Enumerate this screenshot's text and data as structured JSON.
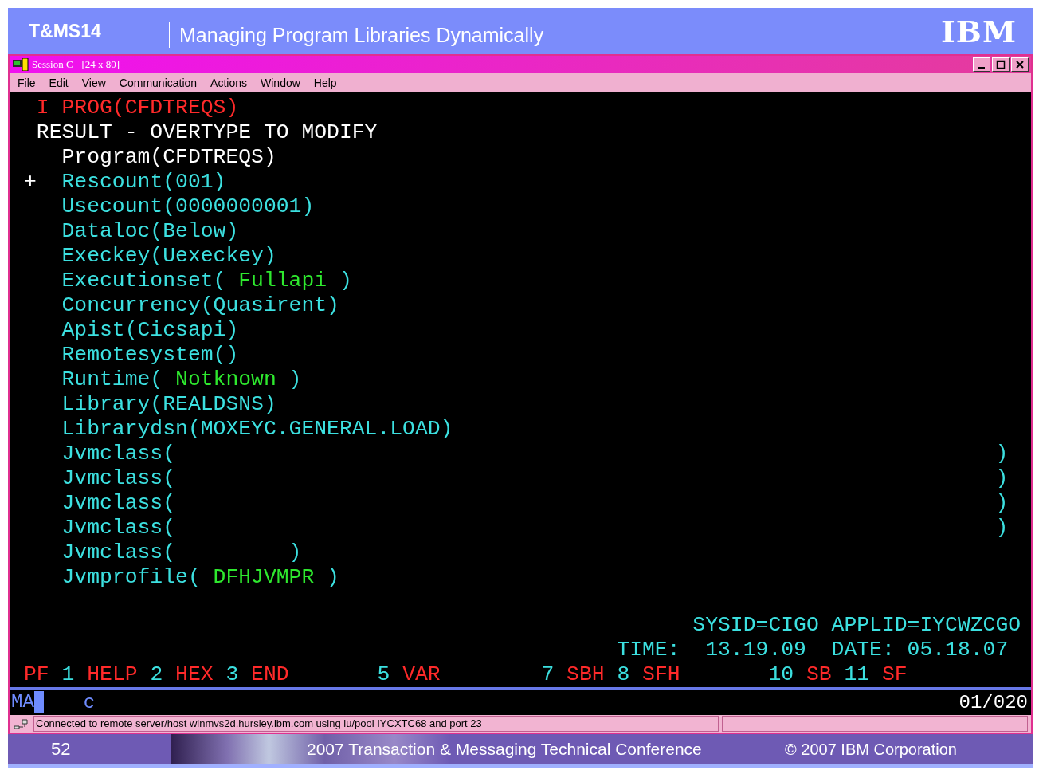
{
  "slide_header": {
    "code": "T&MS14",
    "title": "Managing Program Libraries Dynamically",
    "logo": "IBM"
  },
  "window": {
    "title": "Session C - [24 x 80]",
    "menu": [
      "File",
      "Edit",
      "View",
      "Communication",
      "Actions",
      "Window",
      "Help"
    ]
  },
  "terminal": {
    "lines": [
      {
        "segments": [
          {
            "text": " I PROG(CFDTREQS)",
            "color": "#ff2a2a"
          }
        ]
      },
      {
        "segments": [
          {
            "text": " RESULT - OVERTYPE TO MODIFY",
            "color": "#ffffff"
          }
        ]
      },
      {
        "segments": [
          {
            "text": "   Program(CFDTREQS)",
            "color": "#ffffff"
          }
        ]
      },
      {
        "segments": [
          {
            "text": "+",
            "color": "#ffffff"
          },
          {
            "text": "  Rescount(001)",
            "color": "#3ce0e0"
          }
        ]
      },
      {
        "segments": [
          {
            "text": "   Usecount(0000000001)",
            "color": "#3ce0e0"
          }
        ]
      },
      {
        "segments": [
          {
            "text": "   Dataloc(Below)",
            "color": "#3ce0e0"
          }
        ]
      },
      {
        "segments": [
          {
            "text": "   Execkey(Uexeckey)",
            "color": "#3ce0e0"
          }
        ]
      },
      {
        "segments": [
          {
            "text": "   Executionset(",
            "color": "#3ce0e0"
          },
          {
            "text": " Fullapi ",
            "color": "#2ee82e"
          },
          {
            "text": ")",
            "color": "#3ce0e0"
          }
        ]
      },
      {
        "segments": [
          {
            "text": "   Concurrency(Quasirent)",
            "color": "#3ce0e0"
          }
        ]
      },
      {
        "segments": [
          {
            "text": "   Apist(Cicsapi)",
            "color": "#3ce0e0"
          }
        ]
      },
      {
        "segments": [
          {
            "text": "   Remotesystem()",
            "color": "#3ce0e0"
          }
        ]
      },
      {
        "segments": [
          {
            "text": "   Runtime(",
            "color": "#3ce0e0"
          },
          {
            "text": " Notknown ",
            "color": "#2ee82e"
          },
          {
            "text": ")",
            "color": "#3ce0e0"
          }
        ]
      },
      {
        "segments": [
          {
            "text": "   Library(REALDSNS)",
            "color": "#3ce0e0"
          }
        ]
      },
      {
        "segments": [
          {
            "text": "   Librarydsn(MOXEYC.GENERAL.LOAD)",
            "color": "#3ce0e0"
          }
        ]
      },
      {
        "segments": [
          {
            "text": "   Jvmclass(                                                                 )",
            "color": "#3ce0e0"
          }
        ]
      },
      {
        "segments": [
          {
            "text": "   Jvmclass(                                                                 )",
            "color": "#3ce0e0"
          }
        ]
      },
      {
        "segments": [
          {
            "text": "   Jvmclass(                                                                 )",
            "color": "#3ce0e0"
          }
        ]
      },
      {
        "segments": [
          {
            "text": "   Jvmclass(                                                                 )",
            "color": "#3ce0e0"
          }
        ]
      },
      {
        "segments": [
          {
            "text": "   Jvmclass(         )",
            "color": "#3ce0e0"
          }
        ]
      },
      {
        "segments": [
          {
            "text": "   Jvmprofile(",
            "color": "#3ce0e0"
          },
          {
            "text": " DFHJVMPR ",
            "color": "#2ee82e"
          },
          {
            "text": ")",
            "color": "#3ce0e0"
          }
        ]
      }
    ],
    "bottom_lines": [
      {
        "segments": [
          {
            "text": "                                                     SYSID=CIGO APPLID=IYCWZCGO",
            "color": "#3ce0e0"
          }
        ]
      },
      {
        "segments": [
          {
            "text": "                                               TIME:  13.19.09  DATE: 05.18.07",
            "color": "#3ce0e0"
          }
        ]
      },
      {
        "segments": [
          {
            "text": "PF",
            "color": "#ff2a2a"
          },
          {
            "text": " 1 ",
            "color": "#3ce0e0"
          },
          {
            "text": "HELP",
            "color": "#ff2a2a"
          },
          {
            "text": " 2 ",
            "color": "#3ce0e0"
          },
          {
            "text": "HEX",
            "color": "#ff2a2a"
          },
          {
            "text": " 3 ",
            "color": "#3ce0e0"
          },
          {
            "text": "END",
            "color": "#ff2a2a"
          },
          {
            "text": "       5 ",
            "color": "#3ce0e0"
          },
          {
            "text": "VAR",
            "color": "#ff2a2a"
          },
          {
            "text": "        7 ",
            "color": "#3ce0e0"
          },
          {
            "text": "SBH",
            "color": "#ff2a2a"
          },
          {
            "text": " 8 ",
            "color": "#3ce0e0"
          },
          {
            "text": "SFH",
            "color": "#ff2a2a"
          },
          {
            "text": "       10 ",
            "color": "#3ce0e0"
          },
          {
            "text": "SB",
            "color": "#ff2a2a"
          },
          {
            "text": " 11 ",
            "color": "#3ce0e0"
          },
          {
            "text": "SF",
            "color": "#ff2a2a"
          }
        ]
      }
    ],
    "oia": {
      "indicator": "MA",
      "input": "c",
      "cursor_position": "01/020"
    }
  },
  "status_bar": {
    "message": "Connected to remote server/host winmvs2d.hursley.ibm.com using lu/pool IYCXTC68 and port 23"
  },
  "slide_footer": {
    "page": "52",
    "conference": "2007 Transaction & Messaging Technical Conference",
    "copyright": "© 2007  IBM Corporation"
  }
}
